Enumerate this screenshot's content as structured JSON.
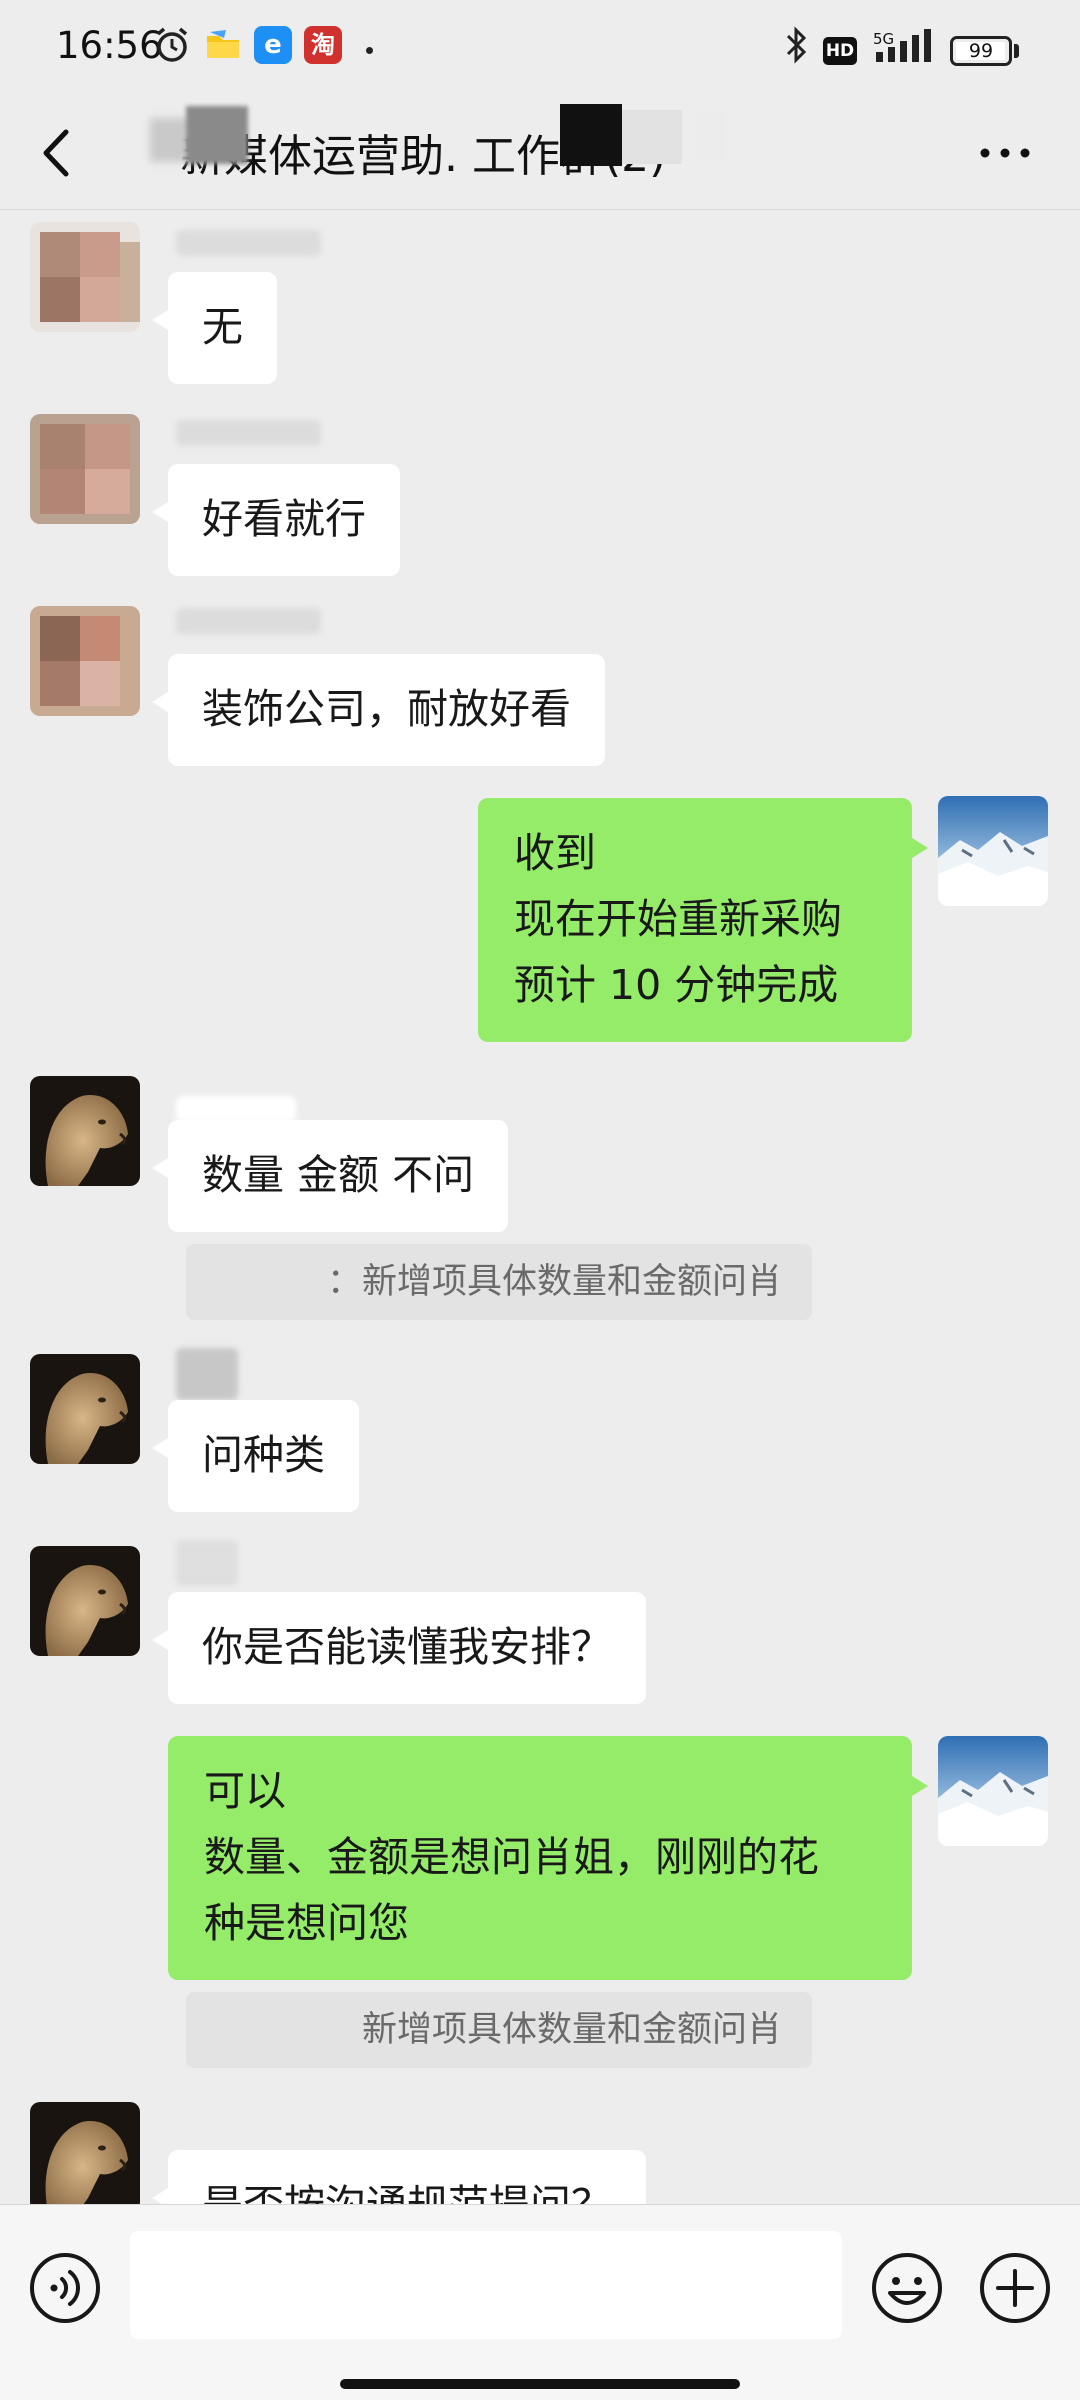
{
  "status_bar": {
    "time": "16:56",
    "network": "5G",
    "hd_label": "HD",
    "battery": "99",
    "app_icons": [
      "alarm-icon",
      "folder-icon",
      "e-browser-icon",
      "taobao-icon"
    ],
    "e_label": "e",
    "tao_label": "淘"
  },
  "header": {
    "title": "新媒体运营助.        工作群(2)"
  },
  "messages": [
    {
      "side": "left",
      "text": "无",
      "avatar": "blurred-person-avatar"
    },
    {
      "side": "left",
      "text": "好看就行",
      "avatar": "blurred-person-avatar"
    },
    {
      "side": "left",
      "text": "装饰公司，耐放好看",
      "avatar": "blurred-person-avatar"
    },
    {
      "side": "right",
      "lines": [
        "收到",
        "现在开始重新采购",
        "预计 10 分钟完成"
      ],
      "avatar": "snow-mountain-avatar"
    },
    {
      "side": "left",
      "text": "数量 金额 不问",
      "avatar": "lioness-avatar",
      "quote": "：新增项具体数量和金额问肖"
    },
    {
      "side": "left",
      "text": "问种类",
      "avatar": "lioness-avatar"
    },
    {
      "side": "left",
      "text": "你是否能读懂我安排？",
      "avatar": "lioness-avatar"
    },
    {
      "side": "right",
      "lines": [
        "可以",
        "数量、金额是想问肖姐，刚刚的花",
        "种是想问您"
      ],
      "avatar": "snow-mountain-avatar",
      "quote": "新增项具体数量和金额问肖"
    },
    {
      "side": "left",
      "text": "是否按沟通规范提问？",
      "avatar": "lioness-avatar"
    }
  ],
  "input_bar": {
    "placeholder": "",
    "buttons": [
      "voice-button",
      "emoji-button",
      "plus-button"
    ]
  },
  "colors": {
    "background": "#ededed",
    "outgoing_bubble": "#95ec69",
    "incoming_bubble": "#ffffff"
  }
}
